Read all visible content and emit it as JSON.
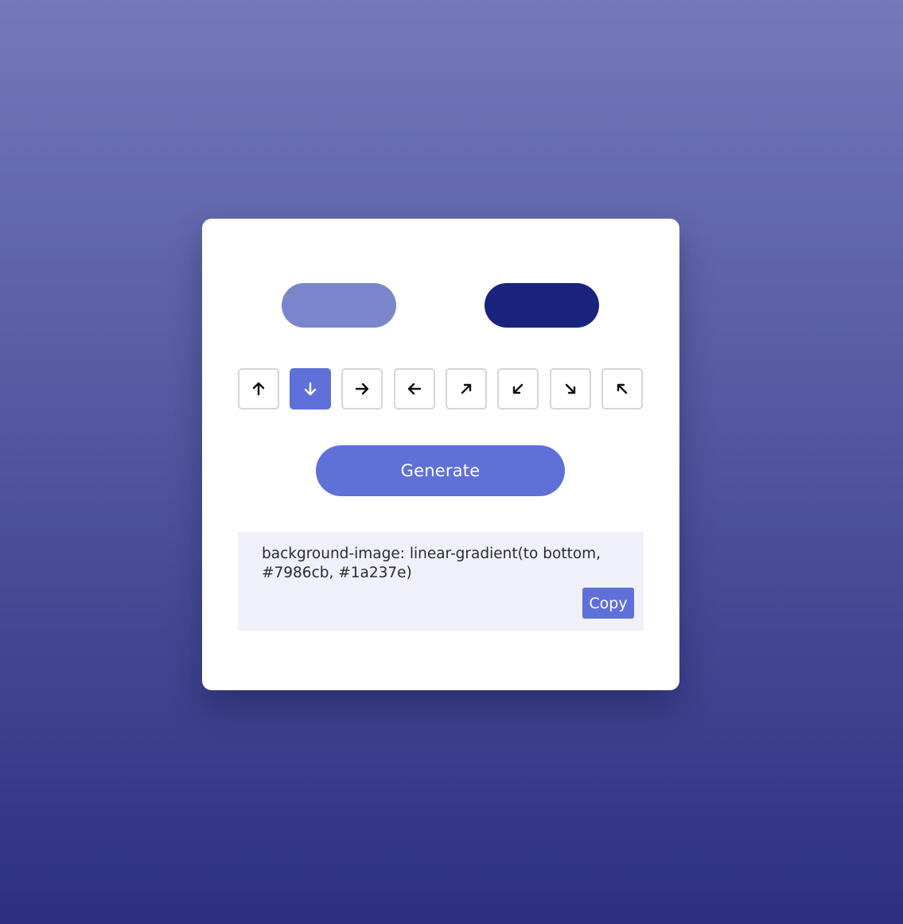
{
  "colors": {
    "first": "#7986cb",
    "second": "#1a237e",
    "accent": "#5f70d8"
  },
  "directions": [
    {
      "name": "up",
      "icon": "arrow-up-icon",
      "active": false
    },
    {
      "name": "down",
      "icon": "arrow-down-icon",
      "active": true
    },
    {
      "name": "right",
      "icon": "arrow-right-icon",
      "active": false
    },
    {
      "name": "left",
      "icon": "arrow-left-icon",
      "active": false
    },
    {
      "name": "up-right",
      "icon": "arrow-up-right-icon",
      "active": false
    },
    {
      "name": "down-left",
      "icon": "arrow-down-left-icon",
      "active": false
    },
    {
      "name": "down-right",
      "icon": "arrow-down-right-icon",
      "active": false
    },
    {
      "name": "up-left",
      "icon": "arrow-up-left-icon",
      "active": false
    }
  ],
  "generate_label": "Generate",
  "output": {
    "code": "background-image: linear-gradient(to bottom, #7986cb, #1a237e)",
    "copy_label": "Copy"
  }
}
